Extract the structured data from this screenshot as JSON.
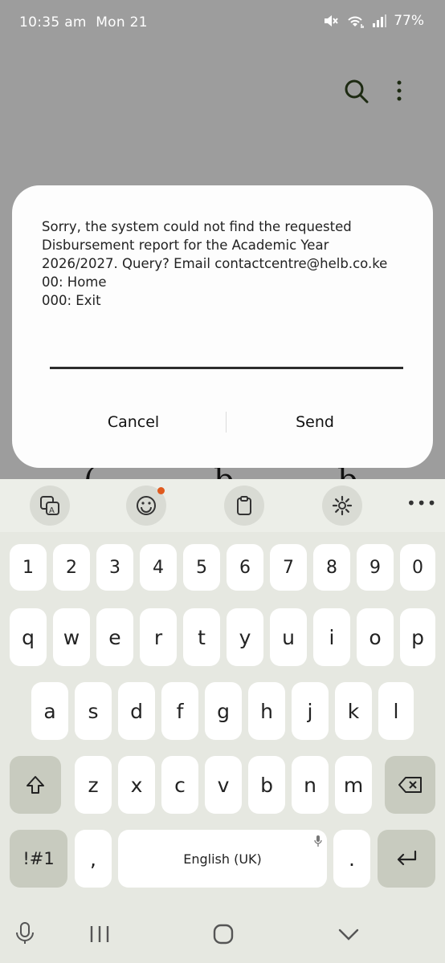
{
  "status": {
    "time": "10:35 am",
    "date": "Mon 21",
    "battery": "77%",
    "icons": [
      "mute-icon",
      "wifi-icon",
      "signal-icon"
    ]
  },
  "appbar": {
    "icons": [
      "search-icon",
      "more-vert-icon"
    ]
  },
  "background_letters": [
    "(",
    "b",
    "b"
  ],
  "dialog": {
    "message": "Sorry, the system could not find the requested\nDisbursement report for the Academic Year\n2026/2027. Query? Email contactcentre@helb.co.ke\n00: Home\n000: Exit",
    "input_value": "",
    "cancel_label": "Cancel",
    "send_label": "Send"
  },
  "keyboard": {
    "toolbar": [
      "translate-icon",
      "emoji-icon",
      "clipboard-icon",
      "settings-icon",
      "more-horiz-icon"
    ],
    "row_numbers": [
      "1",
      "2",
      "3",
      "4",
      "5",
      "6",
      "7",
      "8",
      "9",
      "0"
    ],
    "row1": [
      "q",
      "w",
      "e",
      "r",
      "t",
      "y",
      "u",
      "i",
      "o",
      "p"
    ],
    "row2": [
      "a",
      "s",
      "d",
      "f",
      "g",
      "h",
      "j",
      "k",
      "l"
    ],
    "row3": [
      "z",
      "x",
      "c",
      "v",
      "b",
      "n",
      "m"
    ],
    "symbols_label": "!#1",
    "comma_label": ",",
    "space_label": "English (UK)",
    "period_label": "."
  },
  "navbar": {
    "icons": [
      "keyboard-mic-icon",
      "recents-icon",
      "home-icon",
      "back-icon"
    ]
  },
  "colors": {
    "dim_background": "#9d9d9d",
    "keyboard_background": "#e6e8e1",
    "function_key": "#c8cbbf",
    "badge": "#e05a1e"
  }
}
